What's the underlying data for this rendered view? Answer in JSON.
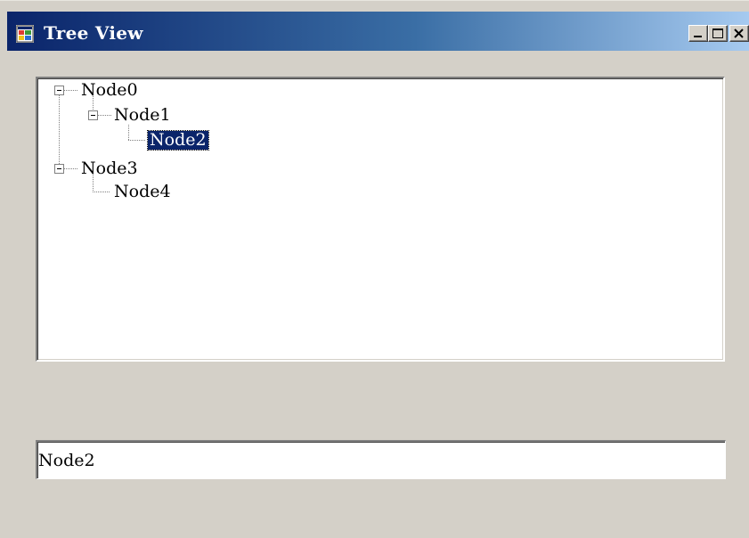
{
  "window": {
    "title": "Tree View",
    "buttons": {
      "minimize": "minimize-icon",
      "maximize": "maximize-icon",
      "close": "close-icon"
    }
  },
  "tree": {
    "nodes": [
      {
        "label": "Node0",
        "expanded": true
      },
      {
        "label": "Node1",
        "expanded": true
      },
      {
        "label": "Node2",
        "selected": true
      },
      {
        "label": "Node3",
        "expanded": true
      },
      {
        "label": "Node4"
      }
    ]
  },
  "textbox": {
    "value": "Node2"
  },
  "colors": {
    "selection": "#0a246a",
    "face": "#d4d0c8",
    "title_start": "#0a246a",
    "title_end": "#a6caf0"
  }
}
